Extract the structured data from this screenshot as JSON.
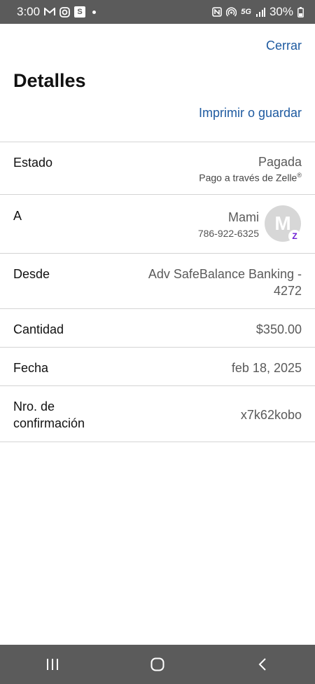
{
  "status_bar": {
    "time": "3:00",
    "network": "5G",
    "battery": "30%",
    "icons": [
      "gmail-icon",
      "instagram-icon",
      "s-app-icon",
      "nfc-icon",
      "hotspot-icon",
      "signal-icon",
      "battery-icon"
    ]
  },
  "header": {
    "close_label": "Cerrar",
    "title": "Detalles",
    "print_label": "Imprimir o guardar"
  },
  "details": {
    "status": {
      "label": "Estado",
      "value": "Pagada",
      "sub": "Pago a través de Zelle",
      "sub_mark": "®"
    },
    "to": {
      "label": "A",
      "name": "Mami",
      "phone": "786-922-6325",
      "avatar_initial": "M",
      "badge": "Z"
    },
    "from": {
      "label": "Desde",
      "value_line1": "Adv SafeBalance Banking -",
      "value_line2": "4272"
    },
    "amount": {
      "label": "Cantidad",
      "value": "$350.00"
    },
    "date": {
      "label": "Fecha",
      "value": "feb 18, 2025"
    },
    "confirmation": {
      "label_line1": "Nro. de",
      "label_line2": "confirmación",
      "value": "x7k62kobo"
    }
  },
  "colors": {
    "link": "#1e5aa0",
    "zelle": "#6d1ed4",
    "bars": "#5b5b5b"
  },
  "nav_bar": {
    "icons": [
      "recent-apps-icon",
      "home-icon",
      "back-icon"
    ]
  }
}
